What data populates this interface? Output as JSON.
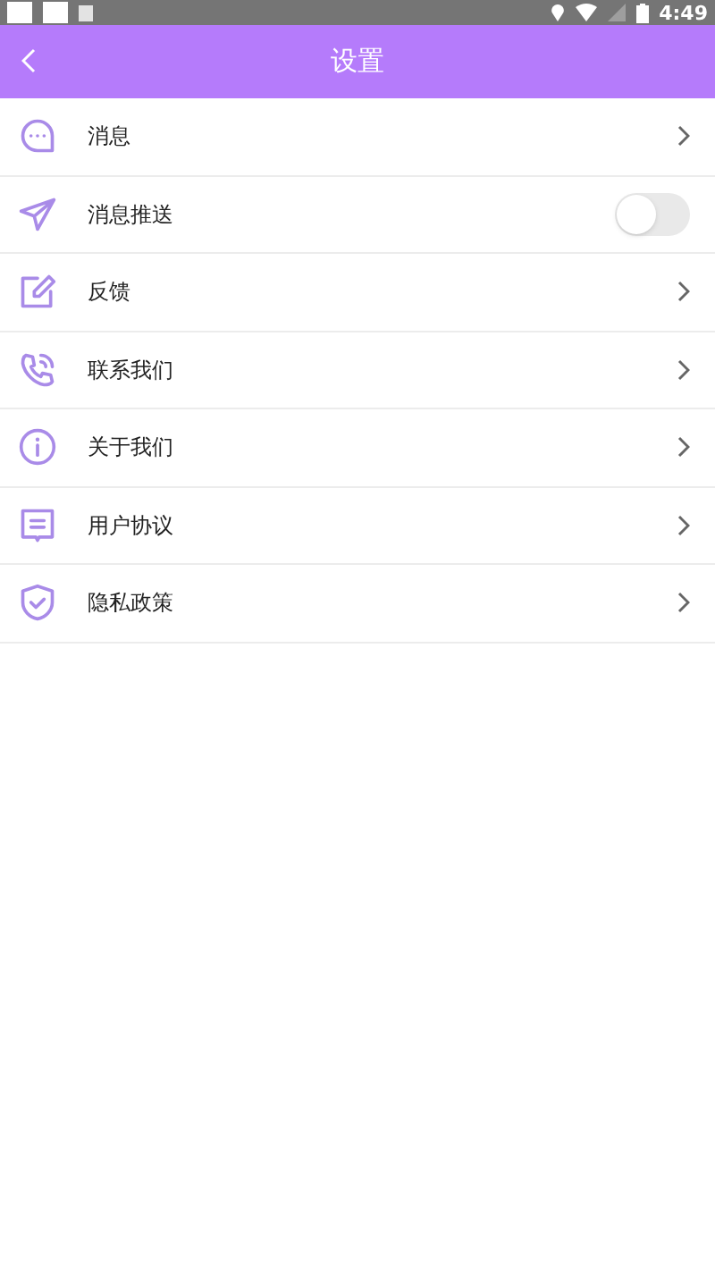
{
  "status_bar": {
    "time": "4:49"
  },
  "header": {
    "title": "设置"
  },
  "items": [
    {
      "label": "消息",
      "kind": "link"
    },
    {
      "label": "消息推送",
      "kind": "toggle",
      "on": false
    },
    {
      "label": "反馈",
      "kind": "link"
    },
    {
      "label": "联系我们",
      "kind": "link"
    },
    {
      "label": "关于我们",
      "kind": "link"
    },
    {
      "label": "用户协议",
      "kind": "link"
    },
    {
      "label": "隐私政策",
      "kind": "link"
    }
  ]
}
